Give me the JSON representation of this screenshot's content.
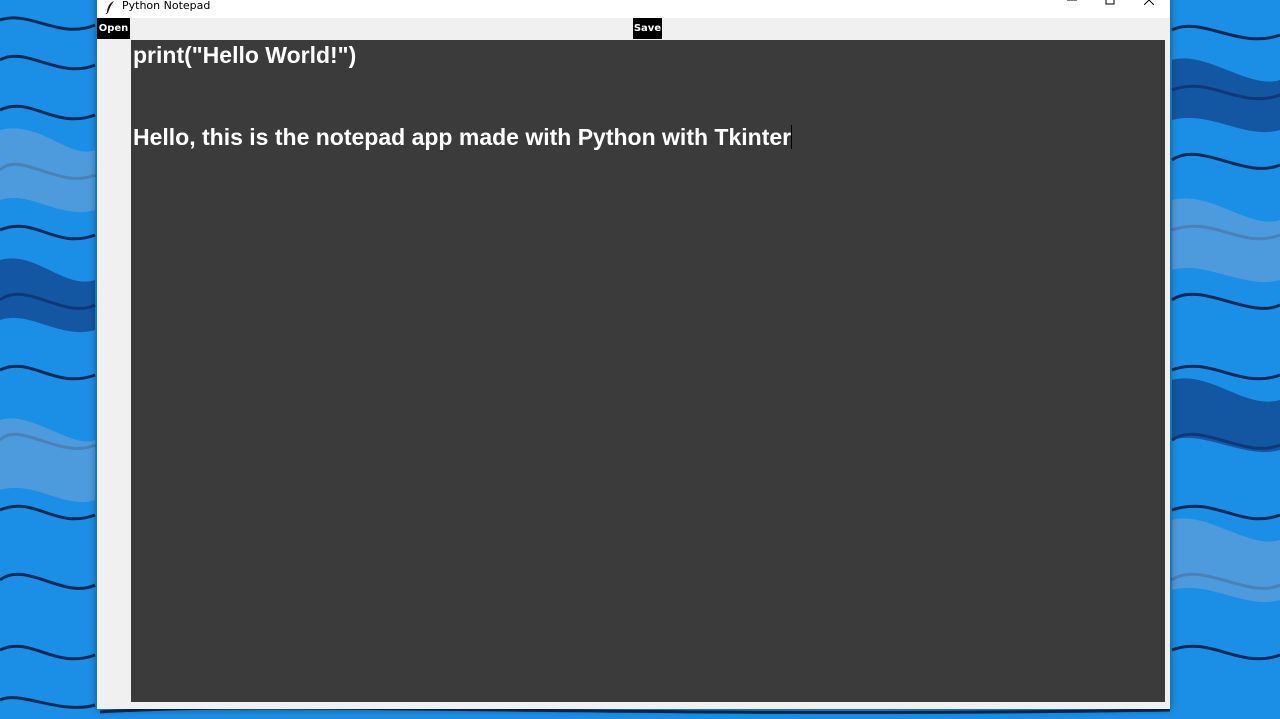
{
  "window": {
    "title": "Python Notepad",
    "icon": "feather-icon",
    "controls": [
      "minimize-icon",
      "maximize-icon",
      "close-icon"
    ]
  },
  "toolbar": {
    "open_label": "Open",
    "save_label": "Save"
  },
  "editor": {
    "lines": [
      "print(\"Hello World!\")",
      "",
      "Hello, this is the notepad app made with Python with Tkinter"
    ],
    "background": "#3b3b3b",
    "text_color": "#ffffff"
  },
  "colors": {
    "button_bg": "#000000",
    "button_text": "#ffffff",
    "window_bg": "#f0f0f0",
    "desktop_blue": "#1b8fe6"
  }
}
